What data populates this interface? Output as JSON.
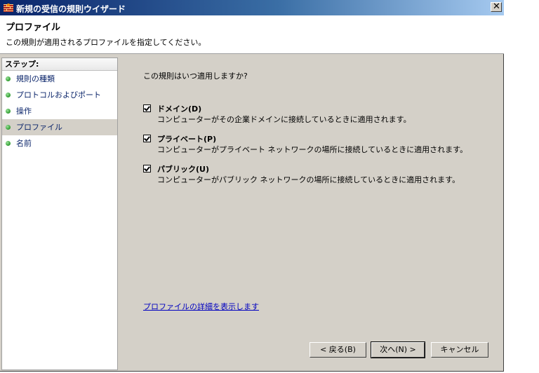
{
  "window": {
    "title": "新規の受信の規則ウイザード",
    "close_glyph": "✕"
  },
  "header": {
    "title": "プロファイル",
    "subtitle": "この規則が適用されるプロファイルを指定してください。"
  },
  "steps": {
    "heading": "ステップ:",
    "items": [
      {
        "label": "規則の種類"
      },
      {
        "label": "プロトコルおよびポート"
      },
      {
        "label": "操作"
      },
      {
        "label": "プロファイル"
      },
      {
        "label": "名前"
      }
    ],
    "active_index": 3
  },
  "main": {
    "question": "この規則はいつ適用しますか?",
    "options": [
      {
        "label": "ドメイン(D)",
        "description": "コンピューターがその企業ドメインに接続しているときに適用されます。",
        "checked": true
      },
      {
        "label": "プライベート(P)",
        "description": "コンピューターがプライベート ネットワークの場所に接続しているときに適用されます。",
        "checked": true
      },
      {
        "label": "パブリック(U)",
        "description": "コンピューターがパブリック ネットワークの場所に接続しているときに適用されます。",
        "checked": true
      }
    ],
    "details_link": "プロファイルの詳細を表示します"
  },
  "buttons": {
    "back": "< 戻る(B)",
    "next": "次へ(N) >",
    "cancel": "キャンセル"
  },
  "colors": {
    "titlebar_start": "#0a246a",
    "titlebar_end": "#a6caf0",
    "dialog_face": "#d4d0c8",
    "link": "#0000c0"
  },
  "icons": {
    "app": "firewall-icon",
    "step_bullet": "green-bullet-icon"
  }
}
